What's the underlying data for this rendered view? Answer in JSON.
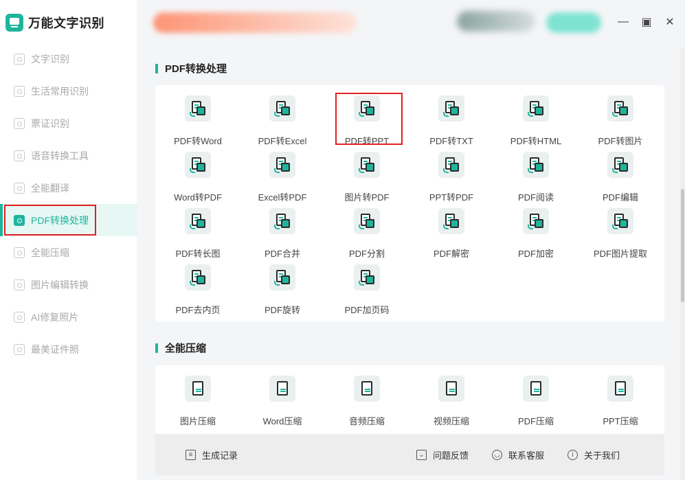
{
  "app": {
    "title": "万能文字识别"
  },
  "sidebar": {
    "items": [
      {
        "label": "文字识别",
        "icon": "scan-text-icon"
      },
      {
        "label": "生活常用识别",
        "icon": "scan-life-icon"
      },
      {
        "label": "票证识别",
        "icon": "scan-ticket-icon"
      },
      {
        "label": "语音转换工具",
        "icon": "voice-icon"
      },
      {
        "label": "全能翻译",
        "icon": "translate-icon"
      },
      {
        "label": "PDF转换处理",
        "icon": "pdf-icon",
        "active": true
      },
      {
        "label": "全能压缩",
        "icon": "compress-icon"
      },
      {
        "label": "图片编辑转换",
        "icon": "image-edit-icon"
      },
      {
        "label": "AI修复照片",
        "icon": "ai-photo-icon"
      },
      {
        "label": "最美证件照",
        "icon": "id-photo-icon"
      }
    ]
  },
  "window": {
    "minimize": "—",
    "maximize": "▣",
    "close": "✕"
  },
  "pdf_section": {
    "title": "PDF转换处理",
    "tools": [
      {
        "label": "PDF转Word"
      },
      {
        "label": "PDF转Excel"
      },
      {
        "label": "PDF转PPT"
      },
      {
        "label": "PDF转TXT"
      },
      {
        "label": "PDF转HTML"
      },
      {
        "label": "PDF转图片"
      },
      {
        "label": "Word转PDF"
      },
      {
        "label": "Excel转PDF"
      },
      {
        "label": "图片转PDF"
      },
      {
        "label": "PPT转PDF"
      },
      {
        "label": "PDF阅读"
      },
      {
        "label": "PDF编辑"
      },
      {
        "label": "PDF转长图"
      },
      {
        "label": "PDF合并"
      },
      {
        "label": "PDF分割"
      },
      {
        "label": "PDF解密"
      },
      {
        "label": "PDF加密"
      },
      {
        "label": "PDF图片提取"
      },
      {
        "label": "PDF去内页"
      },
      {
        "label": "PDF旋转"
      },
      {
        "label": "PDF加页码"
      }
    ]
  },
  "compress_section": {
    "title": "全能压缩",
    "tools": [
      {
        "label": "图片压缩"
      },
      {
        "label": "Word压缩"
      },
      {
        "label": "音频压缩"
      },
      {
        "label": "视频压缩"
      },
      {
        "label": "PDF压缩"
      },
      {
        "label": "PPT压缩"
      }
    ]
  },
  "footer": {
    "history": "生成记录",
    "feedback": "问题反馈",
    "service": "联系客服",
    "about": "关于我们"
  },
  "colors": {
    "accent": "#1fb59c",
    "highlight": "#e02020"
  }
}
